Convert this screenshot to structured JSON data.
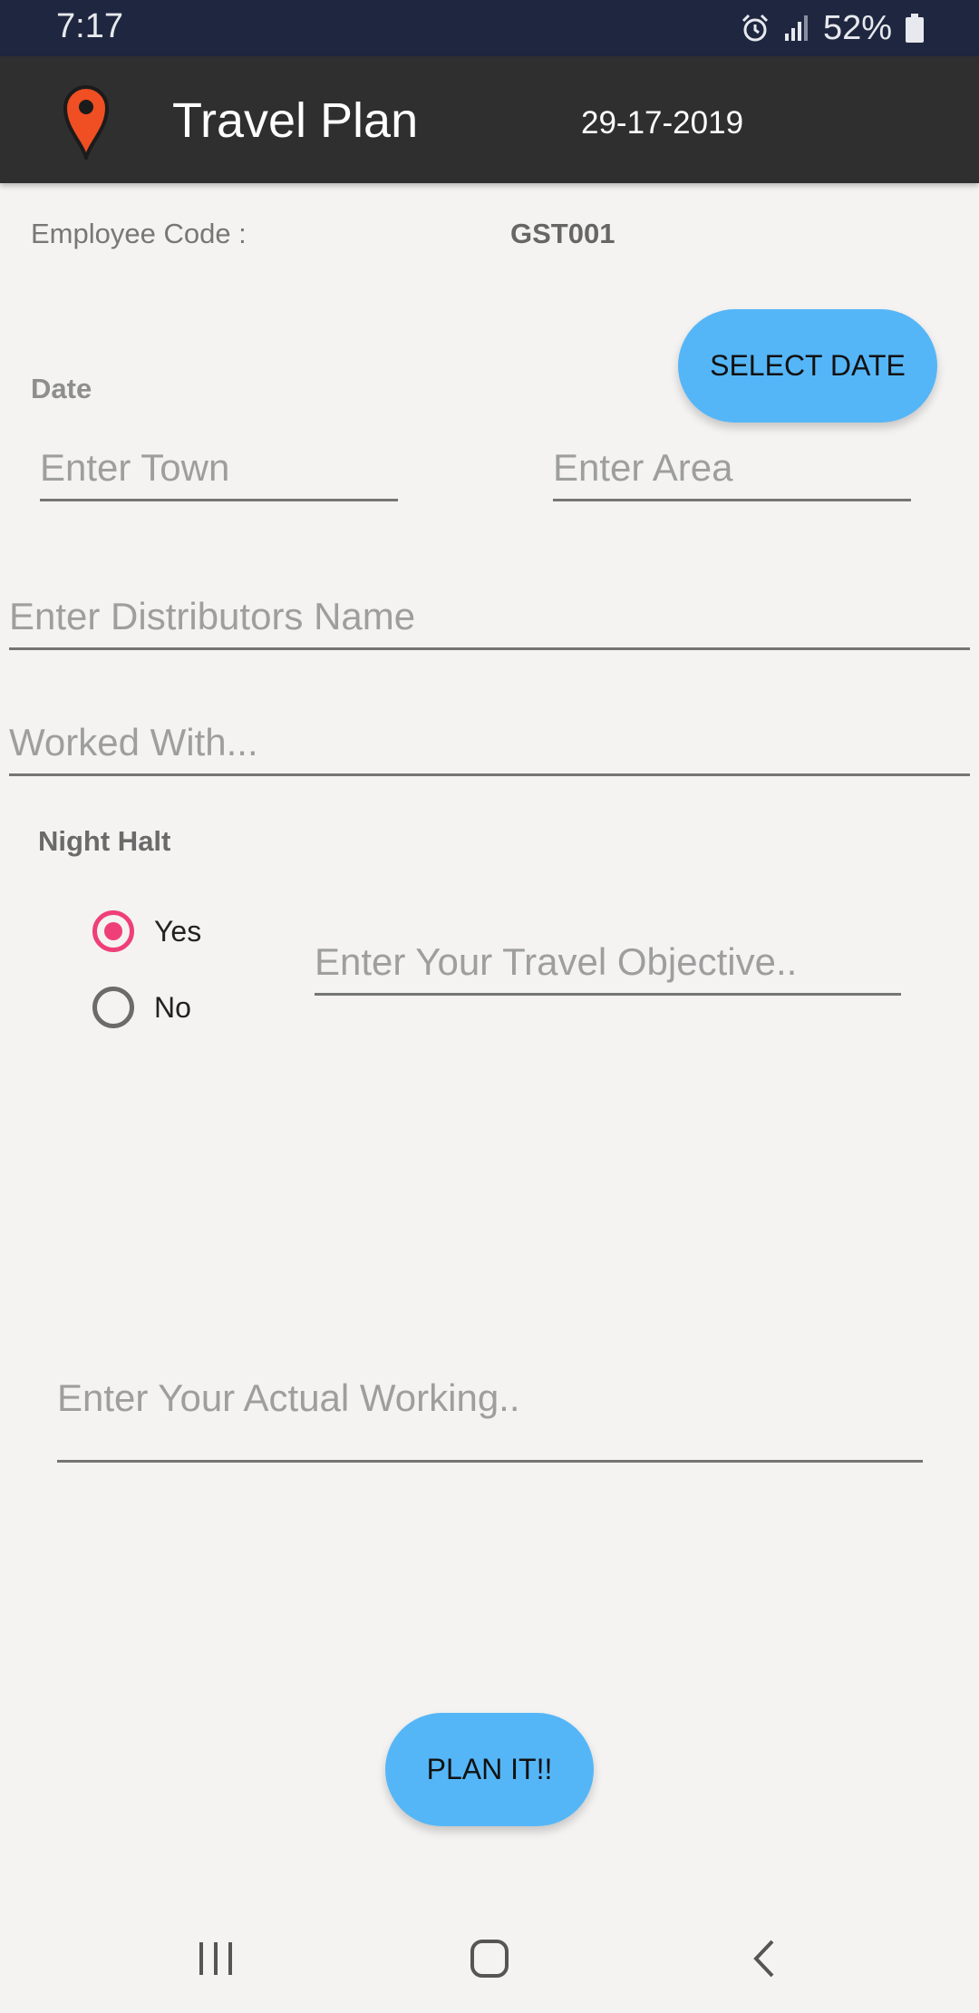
{
  "status_bar": {
    "time": "7:17",
    "battery": "52%",
    "icons": [
      "alarm-icon",
      "signal-icon",
      "battery-icon"
    ]
  },
  "app_bar": {
    "title": "Travel Plan",
    "date": "29-17-2019",
    "logo_icon": "map-pin-icon",
    "logo_color": "#f04e23"
  },
  "form": {
    "employee_code_label": "Employee Code :",
    "employee_code_value": "GST001",
    "date_label": "Date",
    "select_date_button": "SELECT DATE",
    "town_placeholder": "Enter Town",
    "area_placeholder": "Enter Area",
    "distributor_placeholder": "Enter Distributors Name",
    "worked_with_placeholder": "Worked With...",
    "night_halt_label": "Night Halt",
    "night_halt_options": [
      {
        "label": "Yes",
        "selected": true
      },
      {
        "label": "No",
        "selected": false
      }
    ],
    "objective_placeholder": "Enter Your Travel Objective..",
    "actual_working_placeholder": "Enter Your Actual Working..",
    "plan_button": "PLAN IT!!"
  },
  "nav_bar": {
    "icons": [
      "recent-apps-icon",
      "home-icon",
      "back-icon"
    ]
  },
  "colors": {
    "accent": "#55b6f7",
    "radio_selected": "#ef3f78",
    "app_bar": "#2f2f2f",
    "status_bar": "#1f2740",
    "background": "#f4f3f2"
  }
}
